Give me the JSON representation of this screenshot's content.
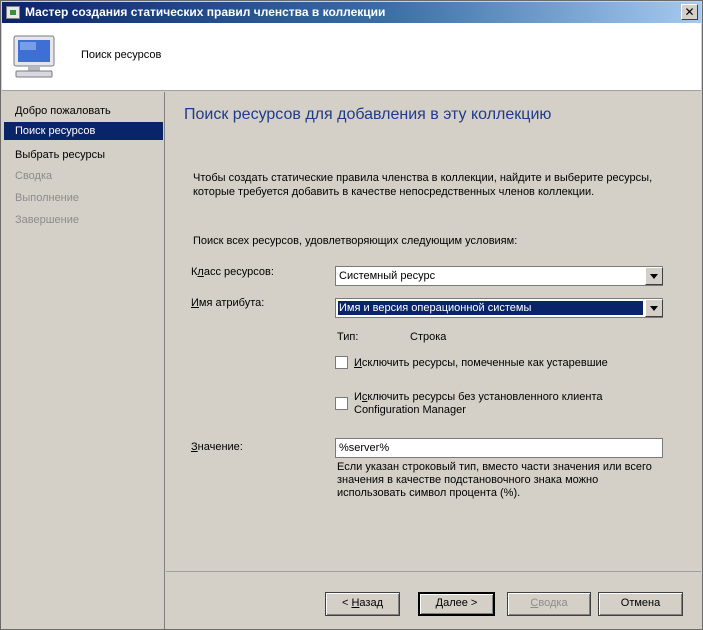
{
  "window": {
    "title": "Мастер создания статических правил членства в коллекции",
    "close_glyph": "✕"
  },
  "header": {
    "title": "Поиск ресурсов",
    "icon": "computer-icon"
  },
  "nav": {
    "items": [
      {
        "label": "Добро пожаловать",
        "state": "normal"
      },
      {
        "label": "Поиск ресурсов",
        "state": "selected"
      },
      {
        "label": "Выбрать ресурсы",
        "state": "normal"
      },
      {
        "label": "Сводка",
        "state": "disabled"
      },
      {
        "label": "Выполнение",
        "state": "disabled"
      },
      {
        "label": "Завершение",
        "state": "disabled"
      }
    ]
  },
  "main": {
    "title": "Поиск ресурсов для добавления в эту коллекцию",
    "description": "Чтобы создать статические правила членства в коллекции, найдите и выберите ресурсы, которые требуется добавить в качестве непосредственных членов коллекции.",
    "criteria_label": "Поиск всех ресурсов, удовлетворяющих следующим условиям:",
    "resource_class": {
      "label_pre": "К",
      "label_under": "л",
      "label_post": "асс ресурсов:",
      "value": "Системный ресурс"
    },
    "attribute_name": {
      "label_pre": "",
      "label_under": "И",
      "label_post": "мя атрибута:",
      "value": "Имя и версия операционной системы"
    },
    "type": {
      "label": "Тип:",
      "value": "Строка"
    },
    "exclude_obsolete": {
      "label_pre": "",
      "label_under": "И",
      "label_post": "сключить ресурсы, помеченные как устаревшие",
      "checked": false
    },
    "exclude_no_client": {
      "label_line1_pre": "И",
      "label_line1_under": "с",
      "label_line1_post": "ключить ресурсы без установленного клиента",
      "label_line2": "Configuration Manager",
      "checked": false
    },
    "value": {
      "label_pre": "",
      "label_under": "З",
      "label_post": "начение:",
      "input": "%server%"
    },
    "hint": "Если указан строковый тип, вместо части значения или всего значения в качестве подстановочного знака можно использовать символ процента (%)."
  },
  "footer": {
    "back": {
      "pre": "< ",
      "under": "Н",
      "post": "азад"
    },
    "next": {
      "pre": "",
      "under": "Д",
      "post": "алее >"
    },
    "summary": {
      "pre": "",
      "under": "С",
      "post": "водка"
    },
    "cancel": "Отмена"
  }
}
